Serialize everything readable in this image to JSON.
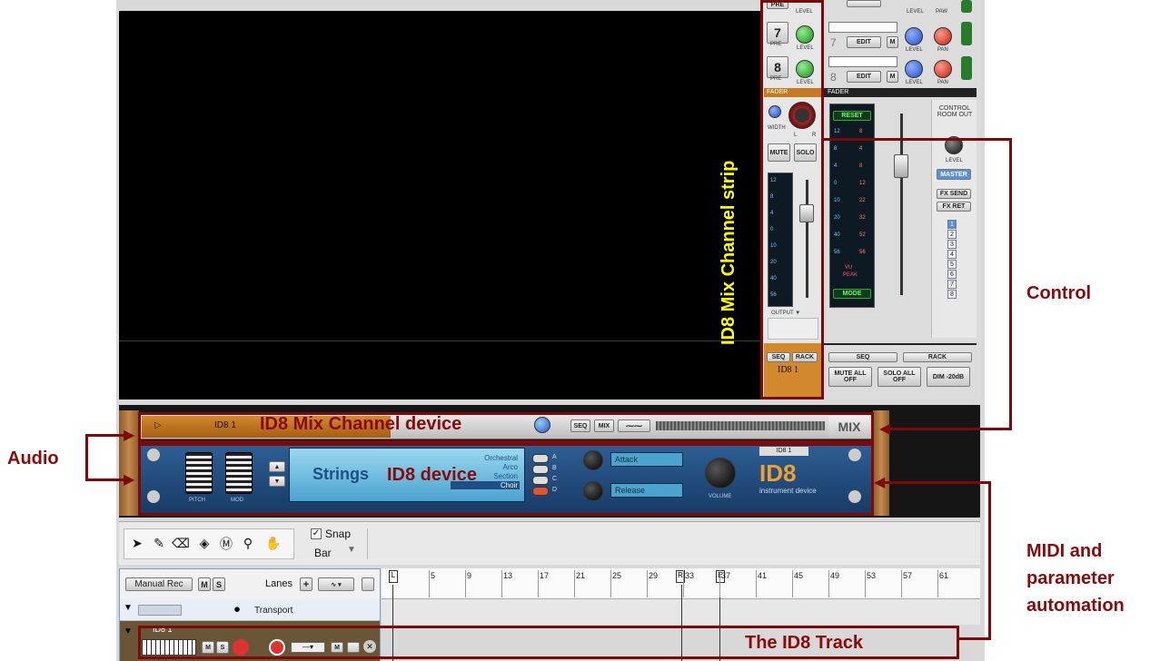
{
  "mixer": {
    "channel_rows": [
      {
        "num": "7",
        "pre": "PRE",
        "level": "LEVEL",
        "edit": "EDIT",
        "m": "M",
        "pan": "PAN"
      },
      {
        "num": "8",
        "pre": "PRE",
        "level": "LEVEL",
        "edit": "EDIT",
        "m": "M",
        "pan": "PAN"
      }
    ],
    "top_labels": {
      "pre": "PRE",
      "level": "LEVEL",
      "pan": "PAW"
    },
    "fader_label_left": "FADER",
    "fader_label_right": "FADER",
    "width_label": "WIDTH",
    "l": "L",
    "r": "R",
    "mute": "MUTE",
    "solo": "SOLO",
    "output": "OUTPUT",
    "seq": "SEQ",
    "rack": "RACK",
    "channel_name": "ID8 1",
    "master": {
      "reset": "RESET",
      "vu": "VU",
      "peak": "PEAK",
      "mode": "MODE",
      "meter_left": [
        "12",
        "8",
        "4",
        "0",
        "10",
        "20",
        "40",
        "56"
      ],
      "meter_right": [
        "8",
        "4",
        "8",
        "12",
        "22",
        "32",
        "52",
        "56"
      ],
      "control_room_out": "CONTROL ROOM OUT",
      "level": "LEVEL",
      "master_btn": "MASTER",
      "fx_send": "FX SEND",
      "fx_ret": "FX RET",
      "bus_numbers": [
        "1",
        "2",
        "3",
        "4",
        "5",
        "6",
        "7",
        "8"
      ],
      "seq": "SEQ",
      "rack": "RACK",
      "mute_all": "MUTE ALL OFF",
      "solo_all": "SOLO ALL OFF",
      "dim": "DIM -20dB"
    },
    "strip_meter": [
      "12",
      "8",
      "4",
      "0",
      "10",
      "20",
      "40",
      "56"
    ]
  },
  "rack": {
    "mix_device": {
      "name": "ID8 1",
      "seq": "SEQ",
      "mix": "MIX",
      "badge": "MIX"
    },
    "id8": {
      "lcd_name": "Strings",
      "categories": [
        "Orchestral",
        "Arco",
        "Section",
        "Choir"
      ],
      "buttons": [
        "A",
        "B",
        "C",
        "D"
      ],
      "attack": "Attack",
      "release": "Release",
      "pitch": "PITCH",
      "mod": "MOD",
      "volume": "VOLUME",
      "patch_name": "ID8 1",
      "logo": "ID8",
      "subtitle": "instrument device"
    }
  },
  "toolbar": {
    "snap": "Snap",
    "snap_value": "Bar"
  },
  "sequencer": {
    "manual_rec": "Manual Rec",
    "m": "M",
    "s": "S",
    "lanes": "Lanes",
    "transport": "Transport",
    "track_name": "ID8 1",
    "ruler": [
      "5",
      "9",
      "13",
      "17",
      "21",
      "25",
      "29",
      "33",
      "37",
      "41",
      "45",
      "49",
      "53",
      "57",
      "61"
    ],
    "markers": {
      "l": "L",
      "r": "R",
      "e": "E"
    }
  },
  "annotations": {
    "strip": "ID8 Mix Channel strip",
    "control": "Control",
    "mix_device": "ID8 Mix Channel device",
    "audio": "Audio",
    "id8_device": "ID8 device",
    "midi": [
      "MIDI and",
      "parameter",
      "automation"
    ],
    "track": "The ID8 Track"
  },
  "colors": {
    "annotation": "#8a0a0a",
    "strip_label": "#ffff00",
    "device_blue": "#1e4a7d",
    "lcd_blue": "#6cc0e4",
    "channel_orange": "#d2892e"
  }
}
